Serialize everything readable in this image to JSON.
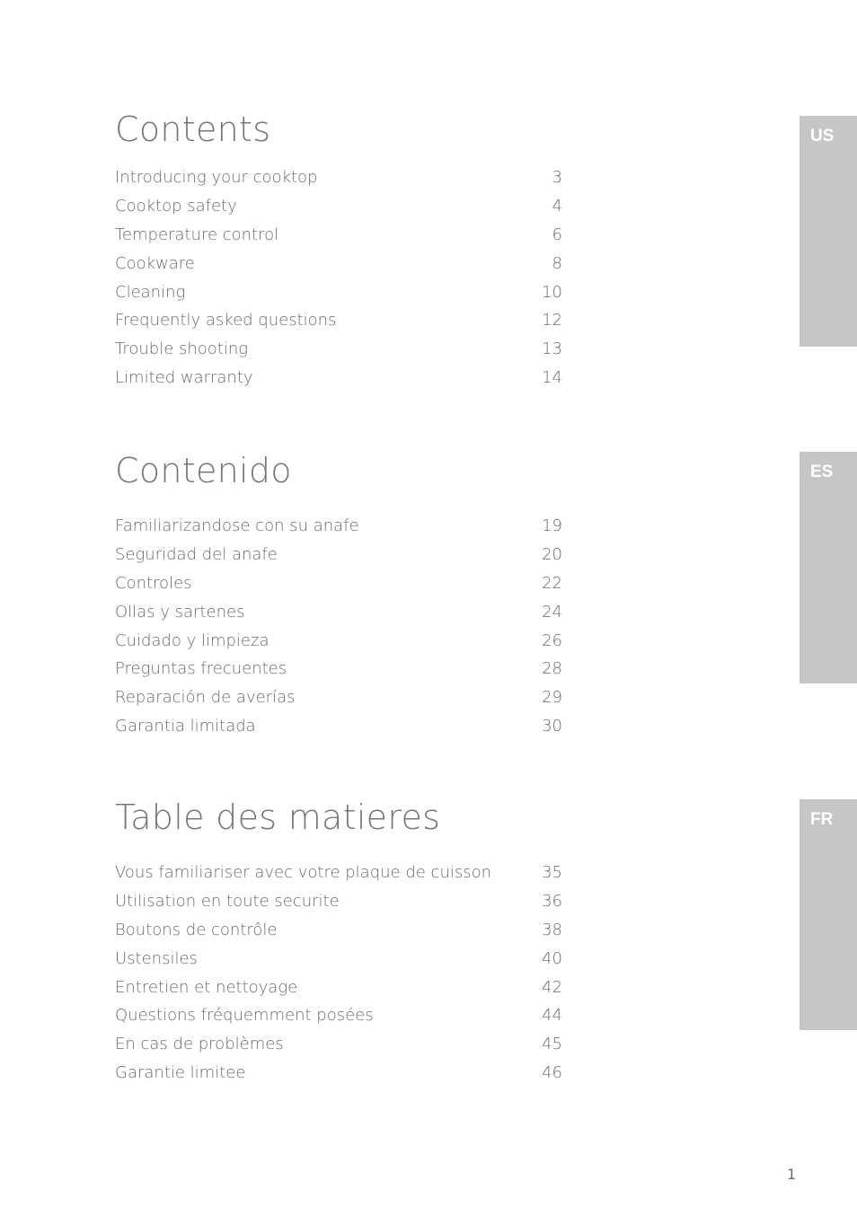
{
  "sections": [
    {
      "title": "Contents",
      "tab": "US",
      "entries": [
        {
          "label": "Introducing your cooktop",
          "page": "3"
        },
        {
          "label": "Cooktop safety",
          "page": "4"
        },
        {
          "label": "Temperature control",
          "page": "6"
        },
        {
          "label": "Cookware",
          "page": "8"
        },
        {
          "label": "Cleaning",
          "page": "10"
        },
        {
          "label": "Frequently asked questions",
          "page": "12"
        },
        {
          "label": "Trouble shooting",
          "page": "13"
        },
        {
          "label": "Limited warranty",
          "page": "14"
        }
      ]
    },
    {
      "title": "Contenido",
      "tab": "ES",
      "entries": [
        {
          "label": "Familiarizandose con su anafe",
          "page": "19"
        },
        {
          "label": "Seguridad del anafe",
          "page": "20"
        },
        {
          "label": "Controles",
          "page": "22"
        },
        {
          "label": "Ollas y sartenes",
          "page": "24"
        },
        {
          "label": "Cuidado y limpieza",
          "page": "26"
        },
        {
          "label": "Preguntas frecuentes",
          "page": "28"
        },
        {
          "label": "Reparación de averías",
          "page": "29"
        },
        {
          "label": "Garantia limitada",
          "page": "30"
        }
      ]
    },
    {
      "title": "Table des matieres",
      "tab": "FR",
      "entries": [
        {
          "label": "Vous familiariser avec votre plaque de cuisson",
          "page": "35"
        },
        {
          "label": "Utilisation en toute securite",
          "page": "36"
        },
        {
          "label": "Boutons de contrôle",
          "page": "38"
        },
        {
          "label": "Ustensiles",
          "page": "40"
        },
        {
          "label": "Entretien et nettoyage",
          "page": "42"
        },
        {
          "label": "Questions fréquemment posées",
          "page": "44"
        },
        {
          "label": "En cas de problèmes",
          "page": "45"
        },
        {
          "label": "Garantie limitee",
          "page": "46"
        }
      ]
    }
  ],
  "colors": {
    "tab_bg": "#c8c5c5",
    "text": "#6a6a6a"
  },
  "page_number": "1"
}
